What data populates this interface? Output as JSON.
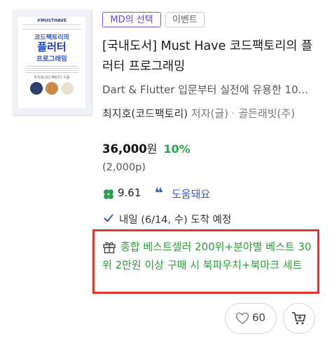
{
  "cover": {
    "series": "#MUSTHAVE",
    "title_line1": "코드팩토리의",
    "title_line2": "플러터",
    "title_line3": "프로그래밍",
    "author": "최지호(코드팩토리) 지음",
    "circle_colors": [
      "#2c3e6e",
      "#c98a4a",
      "#e9e2d4"
    ]
  },
  "badges": {
    "md_pick": "MD의 선택",
    "event": "이벤트"
  },
  "book": {
    "title": "[국내도서] Must Have 코드팩토리의 플러터 프로그래밍",
    "subtitle": "Dart & Flutter 입문부터 실전에 유용한 10...",
    "author": "최지호(코드팩토리)",
    "author_role": "저자(글)",
    "separator": "·",
    "publisher": "골든래빗(주)"
  },
  "price": {
    "amount": "36,000",
    "unit": "원",
    "discount": "10%",
    "points": "(2,000p)"
  },
  "rating": {
    "score": "9.61",
    "review_label": "도움돼요",
    "quote_glyph": "❝"
  },
  "delivery": {
    "text": "내일 (6/14, 수) 도착 예정"
  },
  "benefit": {
    "text": "종합 베스트셀러 200위+분야별 베스트 30위 2만원 이상 구매 시 북파우치+북마크 세트"
  },
  "actions": {
    "like_count": "60"
  },
  "colors": {
    "accent_purple": "#5b4ad9",
    "discount_green": "#2da44e",
    "benefit_green": "#2d9a3b",
    "highlight_red": "#e0372c",
    "link_blue": "#3a56c7"
  },
  "icons": [
    "clover-icon",
    "quote-icon",
    "check-icon",
    "gift-icon",
    "heart-icon",
    "cart-icon"
  ]
}
